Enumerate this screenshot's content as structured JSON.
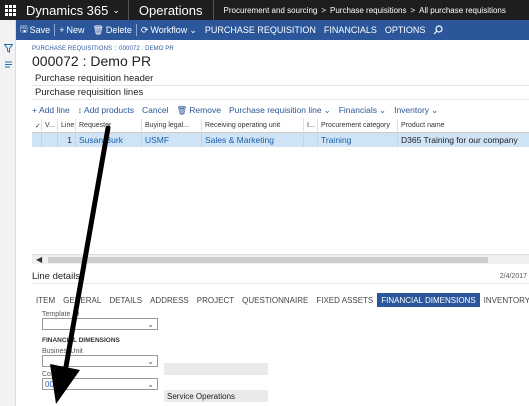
{
  "topbar": {
    "brand": "Dynamics 365",
    "module": "Operations",
    "breadcrumbs": [
      "Procurement and sourcing",
      "Purchase requisitions",
      "All purchase requisitions"
    ]
  },
  "actionpane": {
    "save": "Save",
    "new": "New",
    "delete": "Delete",
    "workflow": "Workflow",
    "tabs": [
      "PURCHASE REQUISITION",
      "FINANCIALS",
      "OPTIONS"
    ]
  },
  "page": {
    "eyebrow": "PURCHASE REQUISITIONS :: 000072 : DEMO PR",
    "title": "000072 : Demo PR"
  },
  "sections": {
    "header": "Purchase requisition header",
    "lines": "Purchase requisition lines"
  },
  "lines_toolbar": {
    "add_line": "Add line",
    "add_products": "Add products",
    "cancel": "Cancel",
    "remove": "Remove",
    "pr_line": "Purchase requisition line",
    "financials": "Financials",
    "inventory": "Inventory"
  },
  "grid": {
    "columns": [
      "V...",
      "Line",
      "Requester",
      "Buying legal...",
      "Receiving operating unit",
      "I...",
      "Procurement category",
      "Product name"
    ],
    "rows": [
      {
        "check": "",
        "v": "",
        "line": "1",
        "requester": "Susan Burk",
        "buying_legal": "USMF",
        "receiving_unit": "Sales & Marketing",
        "i": "",
        "category": "Training",
        "product": "D365 Training for our company"
      }
    ]
  },
  "line_details": {
    "label": "Line details",
    "date": "2/4/2017"
  },
  "detail_tabs": [
    "ITEM",
    "GENERAL",
    "DETAILS",
    "ADDRESS",
    "PROJECT",
    "QUESTIONNAIRE",
    "FIXED ASSETS",
    "FINANCIAL DIMENSIONS",
    "INVENTORY DIM"
  ],
  "active_tab": "FINANCIAL DIMENSIONS",
  "form": {
    "template_label": "Template ID",
    "template_value": "",
    "group_title": "FINANCIAL DIMENSIONS",
    "bu_label": "BusinessUnit",
    "bu_value": "",
    "bu_desc": "",
    "cc_label": "CostCenter",
    "cc_value": "009",
    "cc_desc": "Service Operations"
  },
  "colors": {
    "topbar": "#1e1e1e",
    "action_blue": "#2b579a",
    "selection": "#cfe3f7",
    "link": "#1a5fa8"
  }
}
